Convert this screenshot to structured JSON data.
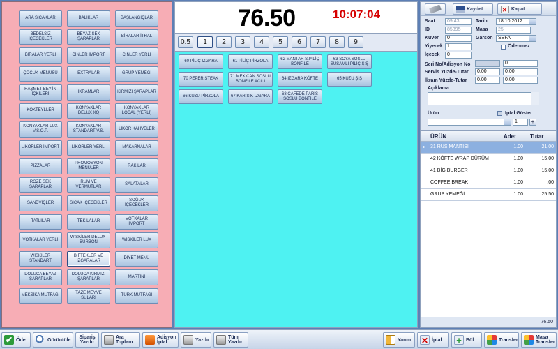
{
  "categories": [
    "ARA SICAKLAR",
    "BALIKLAR",
    "BAŞLANGIÇLAR",
    "BEDELSİZ İÇECEKLER",
    "BEYAZ SEK ŞARAPLAR",
    "BİRALAR İTHAL",
    "BİRALAR YERLİ",
    "CİNLER İMPORT",
    "CİNLER YERLİ",
    "ÇOCUK MENÜSÜ",
    "EXTRALAR",
    "GRUP YEMEĞİ",
    "HAŞMET BEY'İN İÇKİLERİ",
    "İKRAMLAR",
    "KIRMIZI ŞARAPLAR",
    "KOKTEYLLER",
    "KONYAKLAR DELUX XQ",
    "KONYAKLAR LOCAL (YERLİ)",
    "KONYAKLAR LUX V.S.O.P.",
    "KONYAKLAR STANDART V.S.",
    "LİKÖR KAHVELER",
    "LİKÖRLER İMPORT",
    "LİKÖRLER YERLİ",
    "MAKARNALAR",
    "PİZZALAR",
    "PROMOSYON MENÜLER",
    "RAKILAR",
    "ROZE SEK ŞARAPLAR",
    "RUM VE VERMUTLAR",
    "SALATALAR",
    "SANDVİÇLER",
    "SICAK İÇECEKLER",
    "SOĞUK İÇECEKLER",
    "TATLILAR",
    "TEKİLALAR",
    "VOTKALAR İMPORT",
    "VOTKALAR YERLİ",
    "WİSKİLER DELUX-BURBON",
    "WİSKİLER LUX",
    "WİSKİLER STANDART",
    "BİFTEKLER VE IZGARALAR",
    "DİYET MENÜ",
    "DOLUCA BEYAZ ŞARAPLAR",
    "DOLUCA KIRMIZI ŞARAPLAR",
    "MARTİNİ",
    "MEKSİKA MUTFAĞI",
    "TAZE MEYVE SULARI",
    "TÜRK MUTFAĞI"
  ],
  "selected_category": "BİFTEKLER VE IZGARALAR",
  "header": {
    "total": "76.50",
    "clock": "10:07:04"
  },
  "quantities": [
    "0.5",
    "1",
    "2",
    "3",
    "4",
    "5",
    "6",
    "7",
    "8",
    "9"
  ],
  "products": [
    "60 PİLİÇ IZGARA",
    "61 PİLİÇ PİRZOLA",
    "62 MANTAR S.PİLİÇ BONFİLE",
    "63 SOYA SOSLU SUSAMLI PİLİÇ ŞİŞ",
    "70 PEPER STEAK",
    "71 MEXİCAN SOSLU BONFİLE ACILI",
    "64 IZGARA KÖFTE",
    "65 KUZU ŞİŞ",
    "66 KUZU PİRZOLA",
    "67 KARIŞIK IZGARA",
    "68 CAFEDE PARİS SOSLU BONFİLE"
  ],
  "toolbar": {
    "kaydet": "Kaydet",
    "kapat": "Kapat"
  },
  "form": {
    "saat_label": "Saat",
    "saat_value": "09:43",
    "tarih_label": "Tarih",
    "tarih_value": "18.10.2012",
    "id_label": "ID",
    "id_value": "85395",
    "masa_label": "Masa",
    "masa_value": "25",
    "kuver_label": "Kuver",
    "kuver_value": "0",
    "garson_label": "Garson",
    "garson_value": "SEFA",
    "yiyecek_label": "Yiyecek",
    "yiyecek_value": "1",
    "odenmez_label": "Ödenmez",
    "icecek_label": "İçecek",
    "icecek_value": "0",
    "seri_label": "Seri No/Adisyon No",
    "seri_value": "0",
    "servis_label": "Servis Yüzde-Tutar",
    "servis_pct": "0.00",
    "servis_amt": "0.00",
    "ikram_label": "İkram Yüzde-Tutar",
    "ikram_pct": "0.00",
    "ikram_amt": "0.00",
    "aciklama_label": "Açıklama",
    "urun_label": "Ürün",
    "iptal_goster_label": "Iptal Göster",
    "urun_qty": "1"
  },
  "order_grid": {
    "columns": [
      "ÜRÜN",
      "Adet",
      "Tutar"
    ],
    "rows": [
      {
        "name": "31 RUS MANTISI",
        "adet": "1.00",
        "tutar": "21.00"
      },
      {
        "name": "42 KÖFTE WRAP DÜRÜM",
        "adet": "1.00",
        "tutar": "15.00"
      },
      {
        "name": "41 BİG BURGER",
        "adet": "1.00",
        "tutar": "15.00"
      },
      {
        "name": "COFFEE BREAK",
        "adet": "1.00",
        "tutar": ".00"
      },
      {
        "name": "GRUP YEMEĞİ",
        "adet": "1.00",
        "tutar": "25.50"
      }
    ],
    "total": "76.50"
  },
  "bottom_buttons": {
    "ode": "Öde",
    "goruntule": "Görüntüle",
    "siparis": "Sipariş Yazdır",
    "ara_toplam": "Ara Toplam",
    "adisyon_iptal": "Adisyon İptal",
    "yazdir": "Yazdır",
    "tum_yazdir": "Tüm Yazdır",
    "yarim": "Yarım",
    "iptal": "İptal",
    "bol": "Böl",
    "transfer": "Transfer",
    "masa_transfer": "Masa Transfer"
  },
  "colors": {
    "category_bg": "#f7adb5",
    "product_bg": "#4ef2f2",
    "total": "#000000",
    "clock": "#d60000",
    "selected_row": "#8cb0e0"
  }
}
